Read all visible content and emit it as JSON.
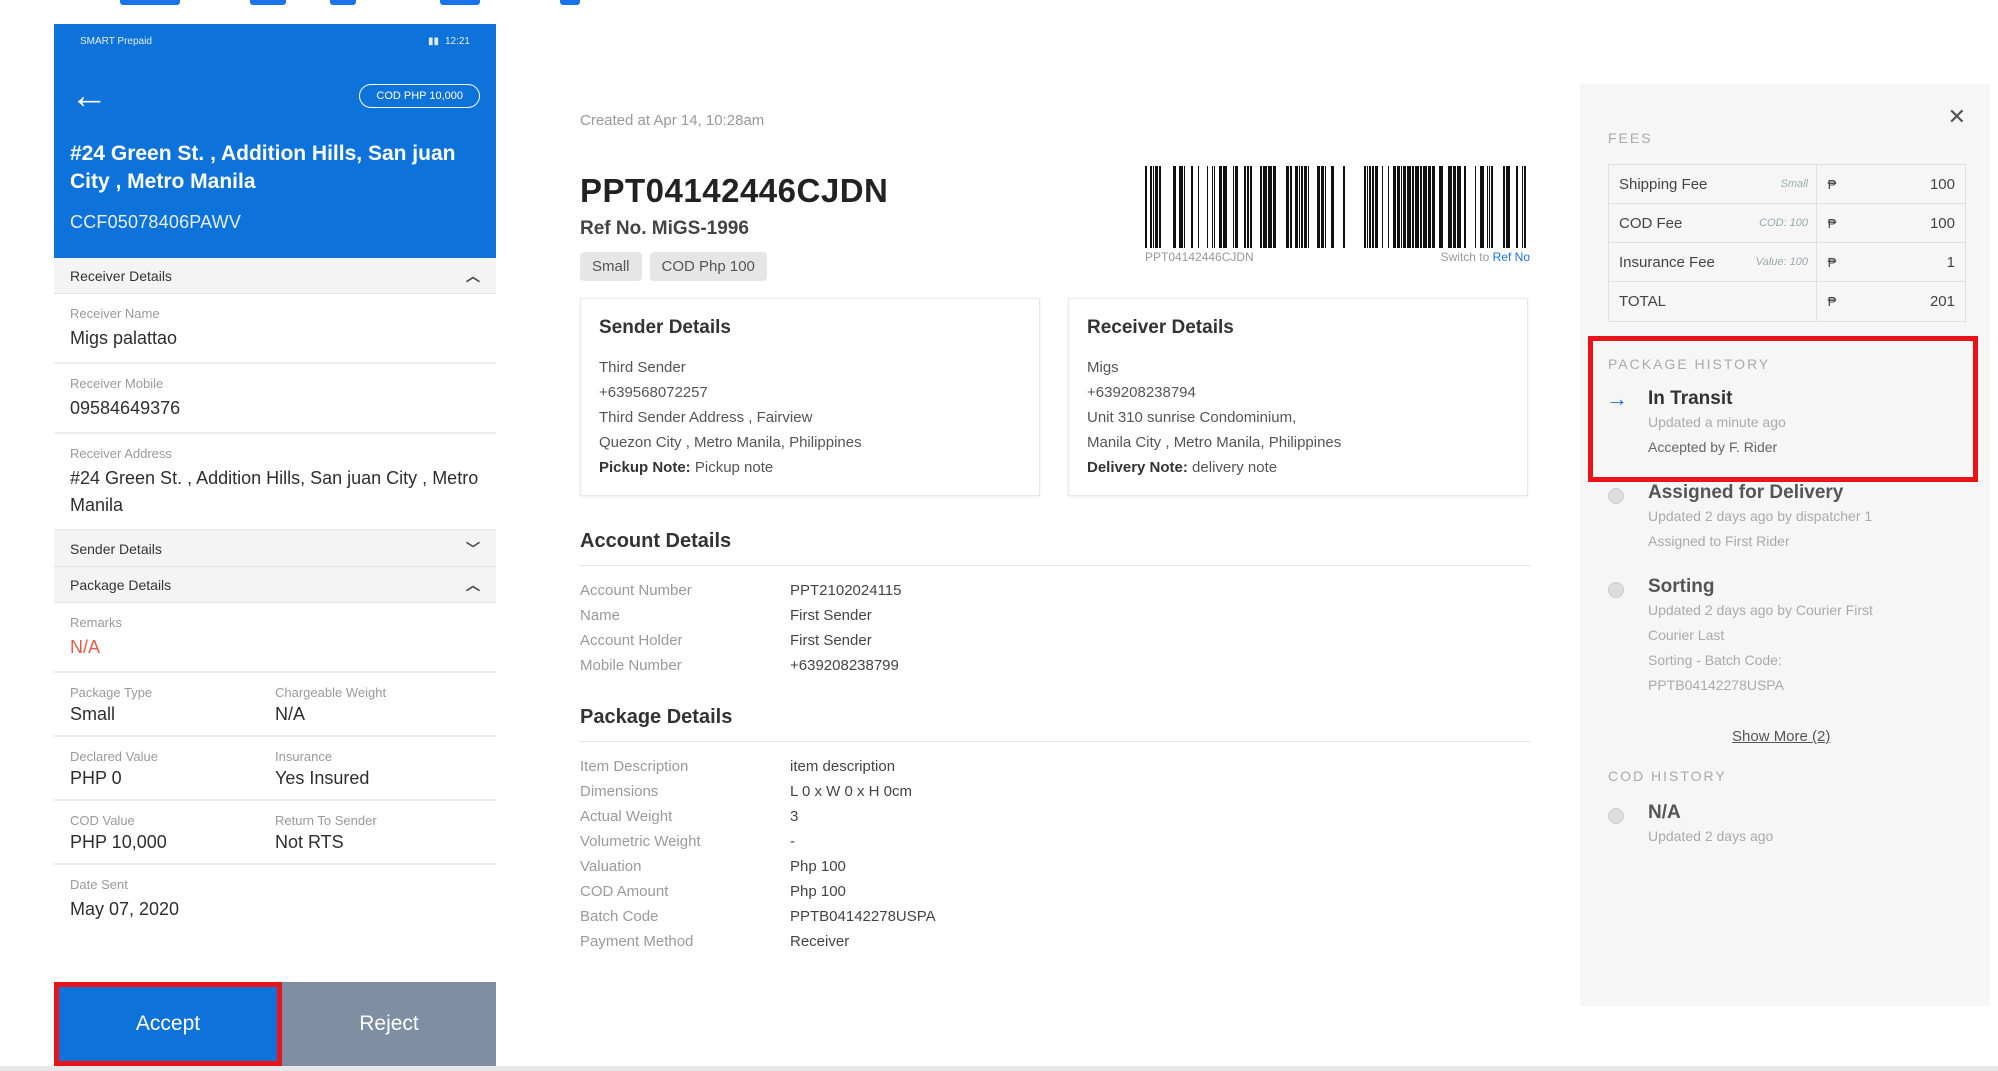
{
  "phone": {
    "status": {
      "carrier": "SMART Prepaid",
      "time": "12:21"
    },
    "cod_pill": "COD PHP 10,000",
    "address": "#24 Green St. , Addition Hills, San juan City , Metro Manila",
    "tracking": "CCF05078406PAWV",
    "sections": {
      "receiver": "Receiver Details",
      "sender": "Sender Details",
      "package": "Package Details"
    },
    "receiver_name": {
      "label": "Receiver Name",
      "value": "Migs palattao"
    },
    "receiver_mobile": {
      "label": "Receiver Mobile",
      "value": "09584649376"
    },
    "receiver_address": {
      "label": "Receiver Address",
      "value": "#24 Green St. , Addition Hills, San juan City , Metro Manila"
    },
    "remarks": {
      "label": "Remarks",
      "value": "N/A"
    },
    "package_type": {
      "label": "Package Type",
      "value": "Small"
    },
    "chargeable_weight": {
      "label": "Chargeable Weight",
      "value": "N/A"
    },
    "declared_value": {
      "label": "Declared Value",
      "value": "PHP 0"
    },
    "insurance": {
      "label": "Insurance",
      "value": "Yes Insured"
    },
    "cod_value": {
      "label": "COD Value",
      "value": "PHP 10,000"
    },
    "return_to_sender": {
      "label": "Return To Sender",
      "value": "Not RTS"
    },
    "date_sent": {
      "label": "Date Sent",
      "value": "May 07, 2020"
    },
    "accept": "Accept",
    "reject": "Reject"
  },
  "detail": {
    "created": "Created at Apr 14, 10:28am",
    "package_id": "PPT04142446CJDN",
    "ref_no": "Ref No. MiGS-1996",
    "tags": [
      "Small",
      "COD Php 100"
    ],
    "barcode_text": "PPT04142446CJDN",
    "switch_prefix": "Switch to",
    "switch_link": "Ref No",
    "sender": {
      "title": "Sender Details",
      "name": "Third Sender",
      "mobile": "+639568072257",
      "address1": "Third Sender Address , Fairview",
      "address2": "Quezon City , Metro Manila, Philippines",
      "note_label": "Pickup Note:",
      "note": "Pickup note"
    },
    "receiver": {
      "title": "Receiver Details",
      "name": "Migs",
      "mobile": "+639208238794",
      "address1": "Unit 310 sunrise Condominium,",
      "address2": "Manila City , Metro Manila, Philippines",
      "note_label": "Delivery Note:",
      "note": "delivery note"
    },
    "account": {
      "title": "Account Details",
      "rows": [
        {
          "k": "Account Number",
          "v": "PPT2102024115"
        },
        {
          "k": "Name",
          "v": "First Sender"
        },
        {
          "k": "Account Holder",
          "v": "First Sender"
        },
        {
          "k": "Mobile Number",
          "v": "+639208238799"
        }
      ]
    },
    "package": {
      "title": "Package Details",
      "rows": [
        {
          "k": "Item Description",
          "v": "item description"
        },
        {
          "k": "Dimensions",
          "v": "L 0 x W 0 x H 0cm"
        },
        {
          "k": "Actual Weight",
          "v": "3"
        },
        {
          "k": "Volumetric Weight",
          "v": "-"
        },
        {
          "k": "Valuation",
          "v": "Php 100"
        },
        {
          "k": "COD Amount",
          "v": "Php 100"
        },
        {
          "k": "Batch Code",
          "v": "PPTB04142278USPA"
        },
        {
          "k": "Payment Method",
          "v": "Receiver"
        }
      ]
    }
  },
  "side": {
    "fees_label": "FEES",
    "fees": [
      {
        "name": "Shipping Fee",
        "note": "Small",
        "cur": "₱",
        "amt": "100"
      },
      {
        "name": "COD Fee",
        "note": "COD: 100",
        "cur": "₱",
        "amt": "100"
      },
      {
        "name": "Insurance Fee",
        "note": "Value: 100",
        "cur": "₱",
        "amt": "1"
      },
      {
        "name": "TOTAL",
        "note": "",
        "cur": "₱",
        "amt": "201"
      }
    ],
    "history_label": "PACKAGE HISTORY",
    "history": [
      {
        "title": "In Transit",
        "line1": "Updated a minute ago",
        "line2": "Accepted by F. Rider"
      },
      {
        "title": "Assigned for Delivery",
        "line1": "Updated 2 days ago by dispatcher 1",
        "line2": "Assigned to First Rider"
      },
      {
        "title": "Sorting",
        "line1": "Updated 2 days ago by Courier First",
        "line2": "Courier Last",
        "line3": "Sorting - Batch Code:",
        "line4": "PPTB04142278USPA"
      }
    ],
    "show_more": "Show More (2)",
    "cod_history_label": "COD HISTORY",
    "cod_history": {
      "title": "N/A",
      "line1": "Updated 2 days ago"
    }
  }
}
